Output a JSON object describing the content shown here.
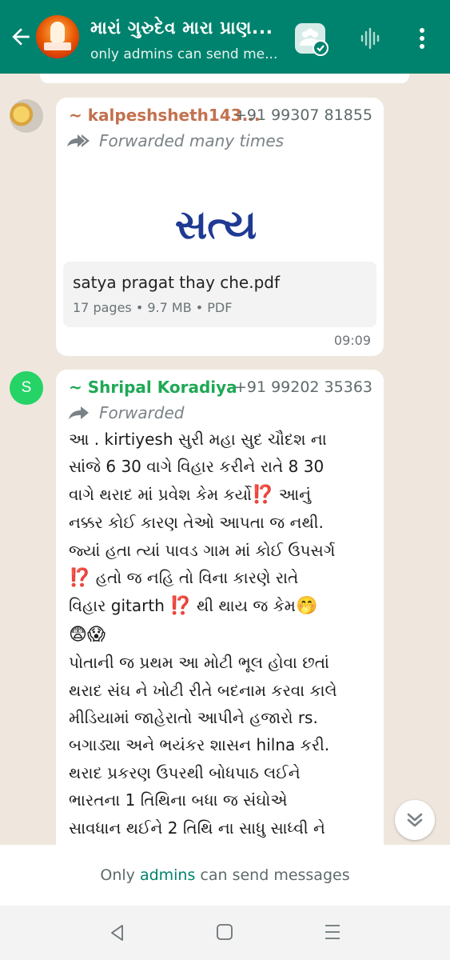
{
  "header": {
    "title": "મારાં ગુરુદેવ મારા પ્રાણ...",
    "subtitle": "only admins can send me..."
  },
  "messages": [
    {
      "sender": "~ kalpeshsheth143...",
      "phone": "+91 99307 81855",
      "forwarded_label": "Forwarded many times",
      "document": {
        "preview_logo_text": "સત્ય",
        "name": "satya pragat thay che.pdf",
        "meta": "17 pages • 9.7 MB • PDF"
      },
      "time": "09:09"
    },
    {
      "sender_initial": "S",
      "sender": "~ Shripal Koradiya",
      "phone": "+91 99202 35363",
      "forwarded_label": "Forwarded",
      "lines": [
        "આ . kirtiyesh સુરી મહા સુદ ચૌદશ ના",
        "સાંજે 6 30 વાગે વિહાર કરીને રાતે  8 30",
        "વાગે થરાદ માં પ્રવેશ કેમ કર્યો",
        "આનું",
        "નક્કર કોઈ કારણ તેઓ આપતા જ નથી.",
        "જ્યાં હતા ત્યાં પાવડ ગામ માં કોઈ ઉપસર્ગ",
        "હતો જ નહિ તો વિના કારણે રાતે",
        "વિહાર gitarth",
        "થી થાય જ કેમ",
        "પોતાની જ પ્રથમ આ મોટી ભૂલ હોવા છતાં",
        "થરાદ સંઘ ને ખોટી રીતે બદનામ કરવા કાલે",
        "મીડિયામાં જાહેરાતો આપીને હજારો rs.",
        "બગાડ્યા અને ભયંકર શાસન hilna કરી.",
        "થરાદ પ્રકરણ ઉપરથી બોધપાઠ લઈને",
        "ભારતના 1 તિથિના બધા જ સંઘોએ",
        "સાવધાન થઈને 2 તિથિ ના સાધુ સાધ્વી ને"
      ],
      "emojis": {
        "interrobang": "⁉️",
        "face_hand": "🤭",
        "fearful": "😨",
        "scream": "😱"
      }
    }
  ],
  "footer": {
    "prefix": "Only ",
    "link": "admins",
    "suffix": " can send messages"
  },
  "colors": {
    "header_bg": "#00836e",
    "chat_bg": "#efe7dd",
    "sender1": "#c2714f",
    "sender2": "#1fa855",
    "logo_blue": "#1f3a93"
  }
}
